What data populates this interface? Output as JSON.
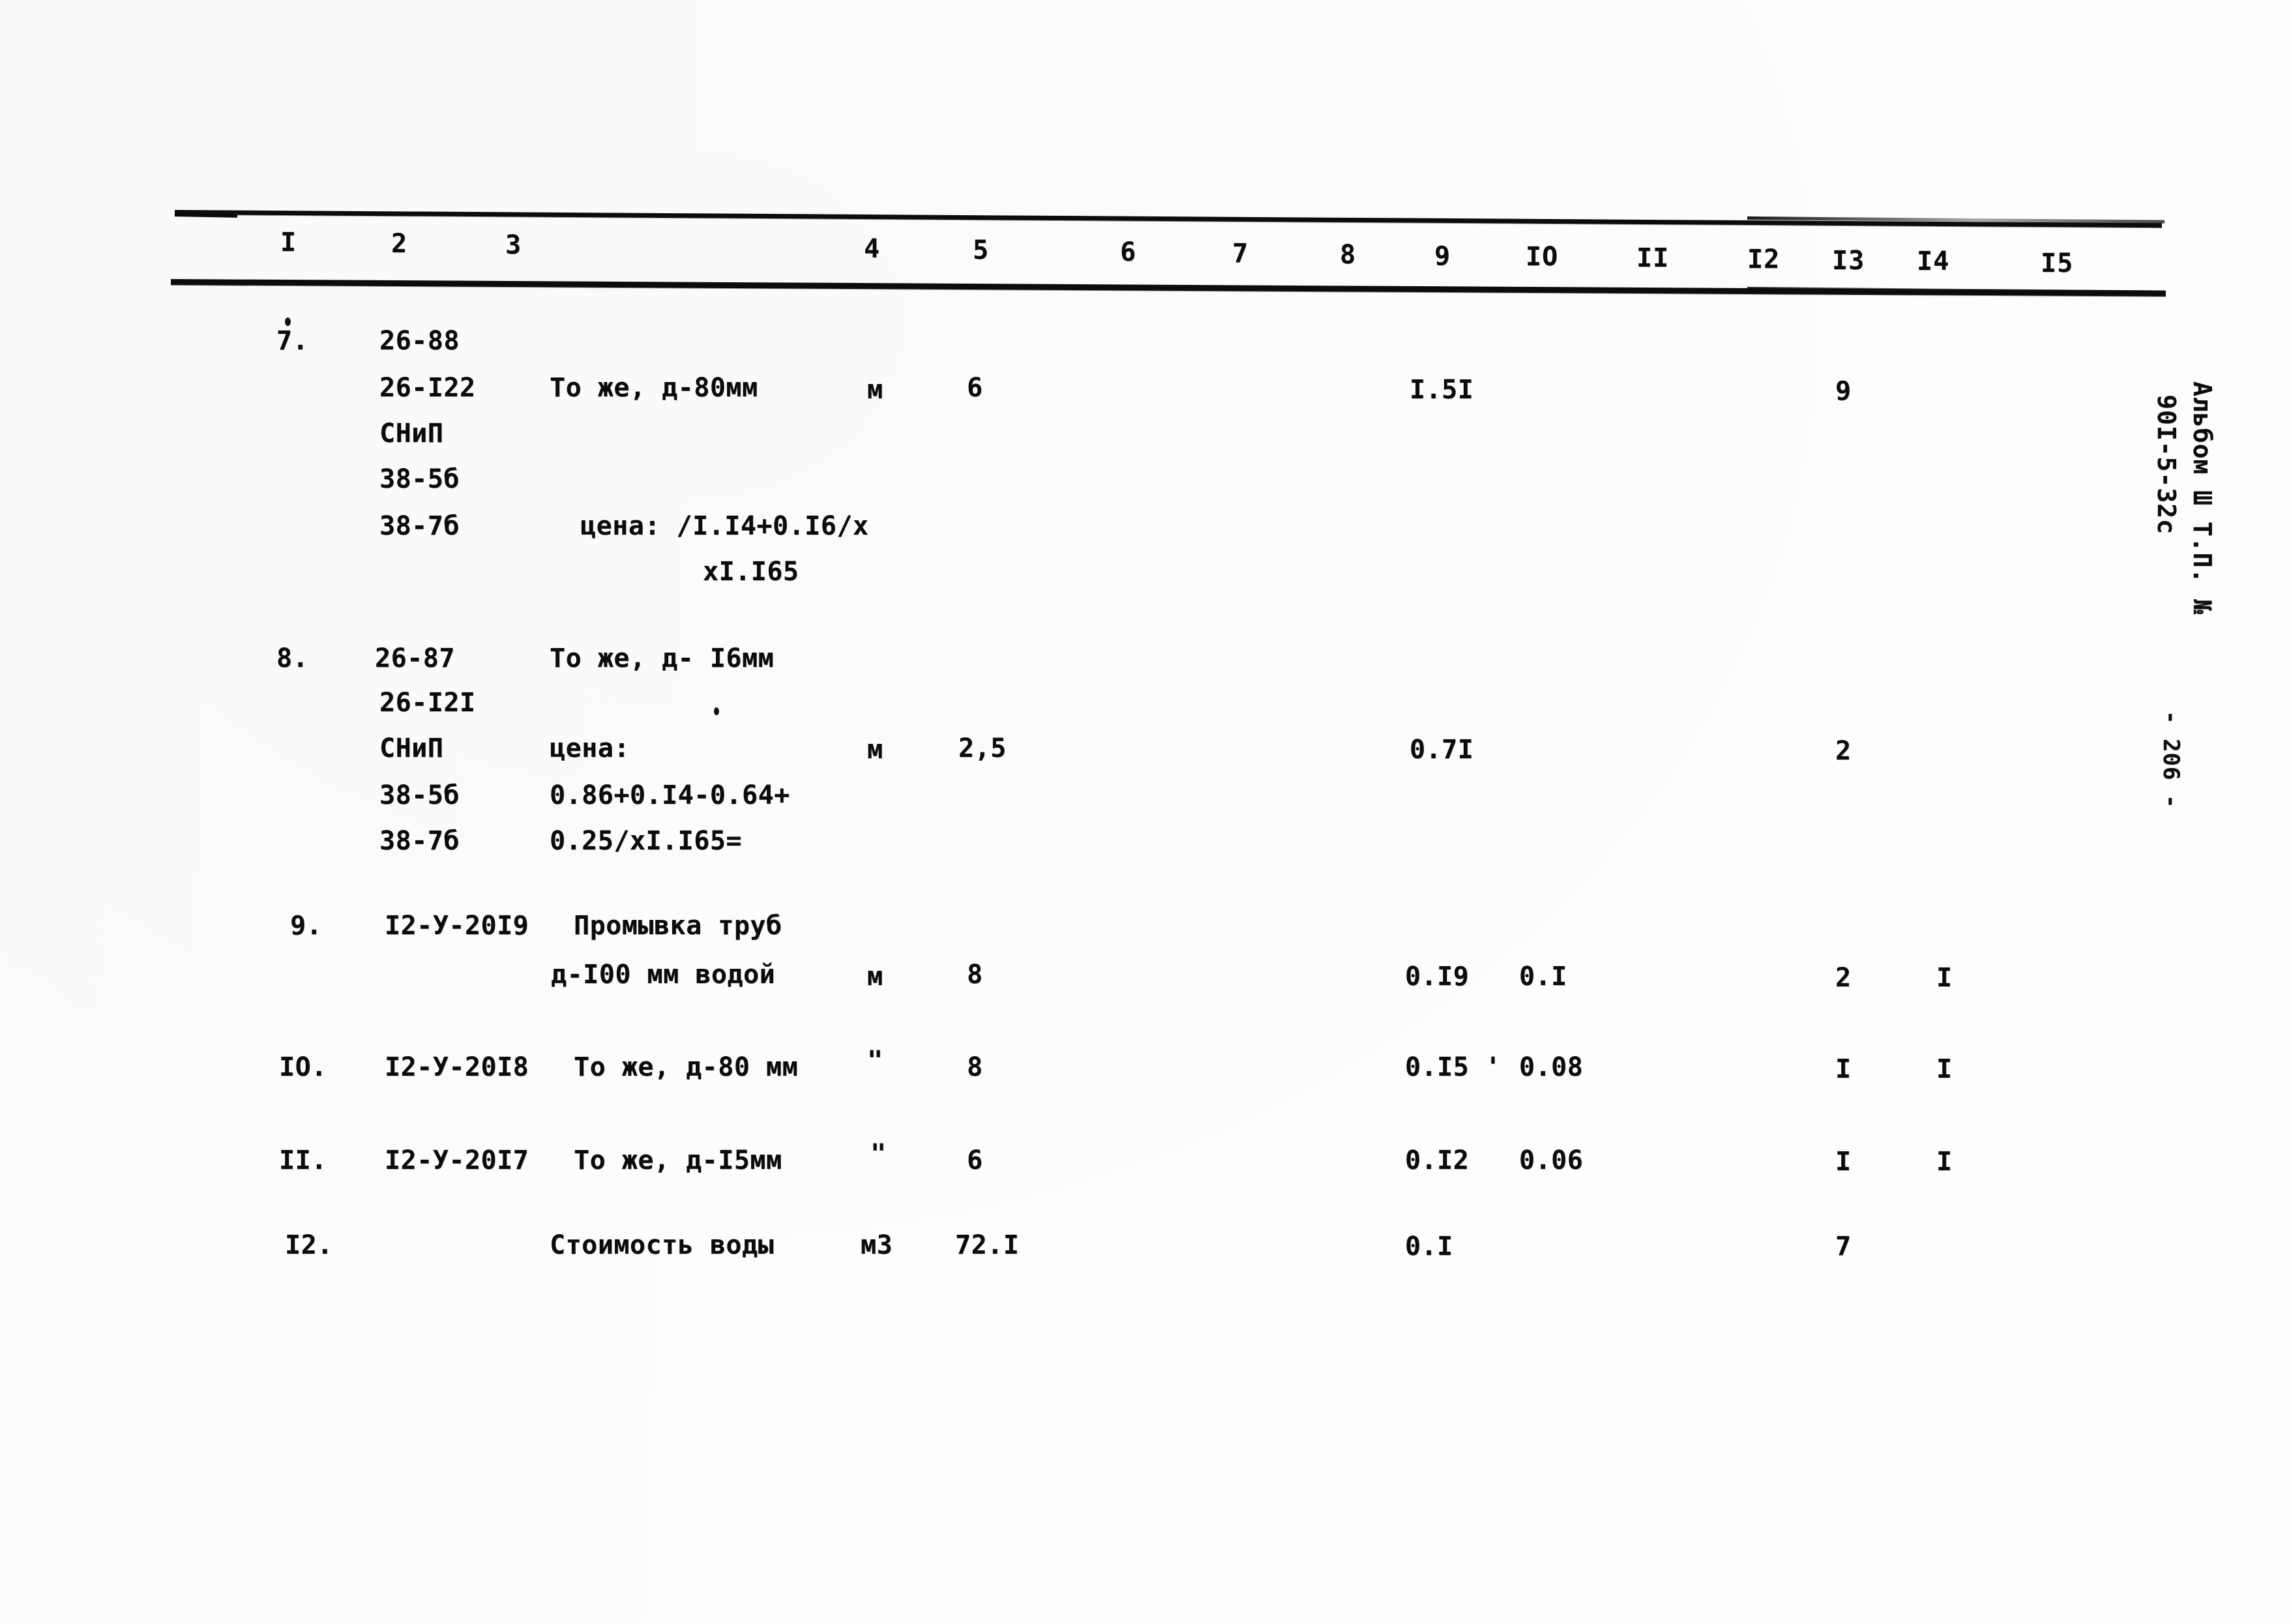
{
  "document": {
    "type": "scanned-estimate-table",
    "margin_label_line1": "Альбом Ш Т.П. №",
    "margin_label_line2": "90I-5-32с",
    "page_marker": "- 206 -"
  },
  "table": {
    "column_headers": [
      "I",
      "2",
      "3",
      "4",
      "5",
      "6",
      "7",
      "8",
      "9",
      "IO",
      "II",
      "I2",
      "I3",
      "I4",
      "I5"
    ],
    "rows": [
      {
        "num": "7.",
        "codes": [
          "26-88",
          "26-I22",
          "СНиП",
          "38-5б",
          "38-7б"
        ],
        "desc_lines": [
          "",
          "То же, д-80мм",
          "",
          "",
          "цена: /I.I4+0.I6/х",
          "хI.I65"
        ],
        "unit": "м",
        "qty": "6",
        "col9": "I.5I",
        "col10": "",
        "col13": "9",
        "col14": ""
      },
      {
        "num": "8.",
        "codes": [
          "26-87",
          "26-I2I",
          "СНиП",
          "38-5б",
          "38-7б"
        ],
        "desc_lines": [
          "То же, д- I6мм",
          "",
          "цена:",
          "0.86+0.I4-0.64+",
          "0.25/хI.I65="
        ],
        "unit": "м",
        "qty": "2,5",
        "col9": "0.7I",
        "col10": "",
        "col13": "2",
        "col14": ""
      },
      {
        "num": "9.",
        "codes": [
          "I2-У-20I9"
        ],
        "desc_lines": [
          "Промывка труб",
          "д-I00 мм водой"
        ],
        "unit": "м",
        "qty": "8",
        "col9": "0.I9",
        "col10": "0.I",
        "col13": "2",
        "col14": "I"
      },
      {
        "num": "IO.",
        "codes": [
          "I2-У-20I8"
        ],
        "desc_lines": [
          "То же, д-80 мм"
        ],
        "unit": "\"",
        "qty": "8",
        "col9": "0.I5 '",
        "col10": "0.08",
        "col13": "I",
        "col14": "I"
      },
      {
        "num": "II.",
        "codes": [
          "I2-У-20I7"
        ],
        "desc_lines": [
          "То же, д-I5мм"
        ],
        "unit": "\"",
        "qty": "6",
        "col9": "0.I2",
        "col10": "0.06",
        "col13": "I",
        "col14": "I"
      },
      {
        "num": "I2.",
        "codes": [],
        "desc_lines": [
          "Стоимость воды"
        ],
        "unit": "м3",
        "qty": "72.I",
        "col9": "0.I",
        "col10": "",
        "col13": "7",
        "col14": ""
      }
    ]
  },
  "cells": {
    "h1": "I",
    "h2": "2",
    "h3": "3",
    "h4": "4",
    "h5": "5",
    "h6": "6",
    "h7": "7",
    "h8": "8",
    "h9": "9",
    "h10": "IO",
    "h11": "II",
    "h12": "I2",
    "h13": "I3",
    "h14": "I4",
    "h15": "I5",
    "r7_num": "7.",
    "r7_c1": "26-88",
    "r7_c2": "26-I22",
    "r7_c3": "СНиП",
    "r7_c4": "38-5б",
    "r7_c5": "38-7б",
    "r7_desc1": "То же, д-80мм",
    "r7_desc2": "цена: /I.I4+0.I6/х",
    "r7_desc3": "хI.I65",
    "r7_unit": "м",
    "r7_qty": "6",
    "r7_col9": "I.5I",
    "r7_col13": "9",
    "r8_num": "8.",
    "r8_c1": "26-87",
    "r8_c2": "26-I2I",
    "r8_c3": "СНиП",
    "r8_c4": "38-5б",
    "r8_c5": "38-7б",
    "r8_desc1": "То же, д- I6мм",
    "r8_desc2": "цена:",
    "r8_desc3": "0.86+0.I4-0.64+",
    "r8_desc4": "0.25/хI.I65=",
    "r8_unit": "м",
    "r8_qty": "2,5",
    "r8_col9": "0.7I",
    "r8_col13": "2",
    "r9_num": "9.",
    "r9_c1": "I2-У-20I9",
    "r9_desc1": "Промывка труб",
    "r9_desc2": "д-I00 мм водой",
    "r9_unit": "м",
    "r9_qty": "8",
    "r9_col9": "0.I9",
    "r9_col10": "0.I",
    "r9_col13": "2",
    "r9_col14": "I",
    "r10_num": "IO.",
    "r10_c1": "I2-У-20I8",
    "r10_desc1": "То же, д-80 мм",
    "r10_unit": "\"",
    "r10_qty": "8",
    "r10_col9": "0.I5 '",
    "r10_col10": "0.08",
    "r10_col13": "I",
    "r10_col14": "I",
    "r11_num": "II.",
    "r11_c1": "I2-У-20I7",
    "r11_desc1": "То же, д-I5мм",
    "r11_unit": "\"",
    "r11_qty": "6",
    "r11_col9": "0.I2",
    "r11_col10": "0.06",
    "r11_col13": "I",
    "r11_col14": "I",
    "r12_num": "I2.",
    "r12_desc1": "Стоимость воды",
    "r12_unit": "м3",
    "r12_qty": "72.I",
    "r12_col9": "0.I",
    "r12_col13": "7"
  },
  "margin": {
    "line1": "Альбом Ш Т.П. №",
    "line2": "90I-5-32с",
    "page": "- 206 -"
  }
}
